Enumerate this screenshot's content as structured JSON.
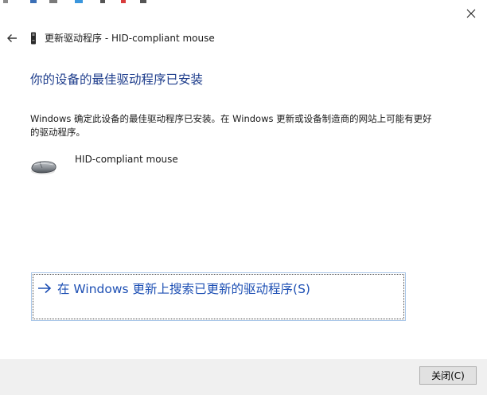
{
  "window": {
    "title": "更新驱动程序 - HID-compliant mouse"
  },
  "main": {
    "heading": "你的设备的最佳驱动程序已安装",
    "description": "Windows 确定此设备的最佳驱动程序已安装。在 Windows 更新或设备制造商的网站上可能有更好的驱动程序。",
    "device_name": "HID-compliant mouse"
  },
  "actions": {
    "search_windows_update": "在 Windows 更新上搜索已更新的驱动程序(S)"
  },
  "footer": {
    "close_label": "关闭(C)"
  },
  "icons": {
    "back": "back-arrow-icon",
    "close": "close-icon",
    "device": "device-icon",
    "mouse": "mouse-icon",
    "link_arrow": "right-arrow-icon"
  },
  "colors": {
    "heading": "#1e3d8c",
    "link": "#1e50b4",
    "footer_bg": "#f0f0f0",
    "button_bg": "#e1e1e1"
  }
}
